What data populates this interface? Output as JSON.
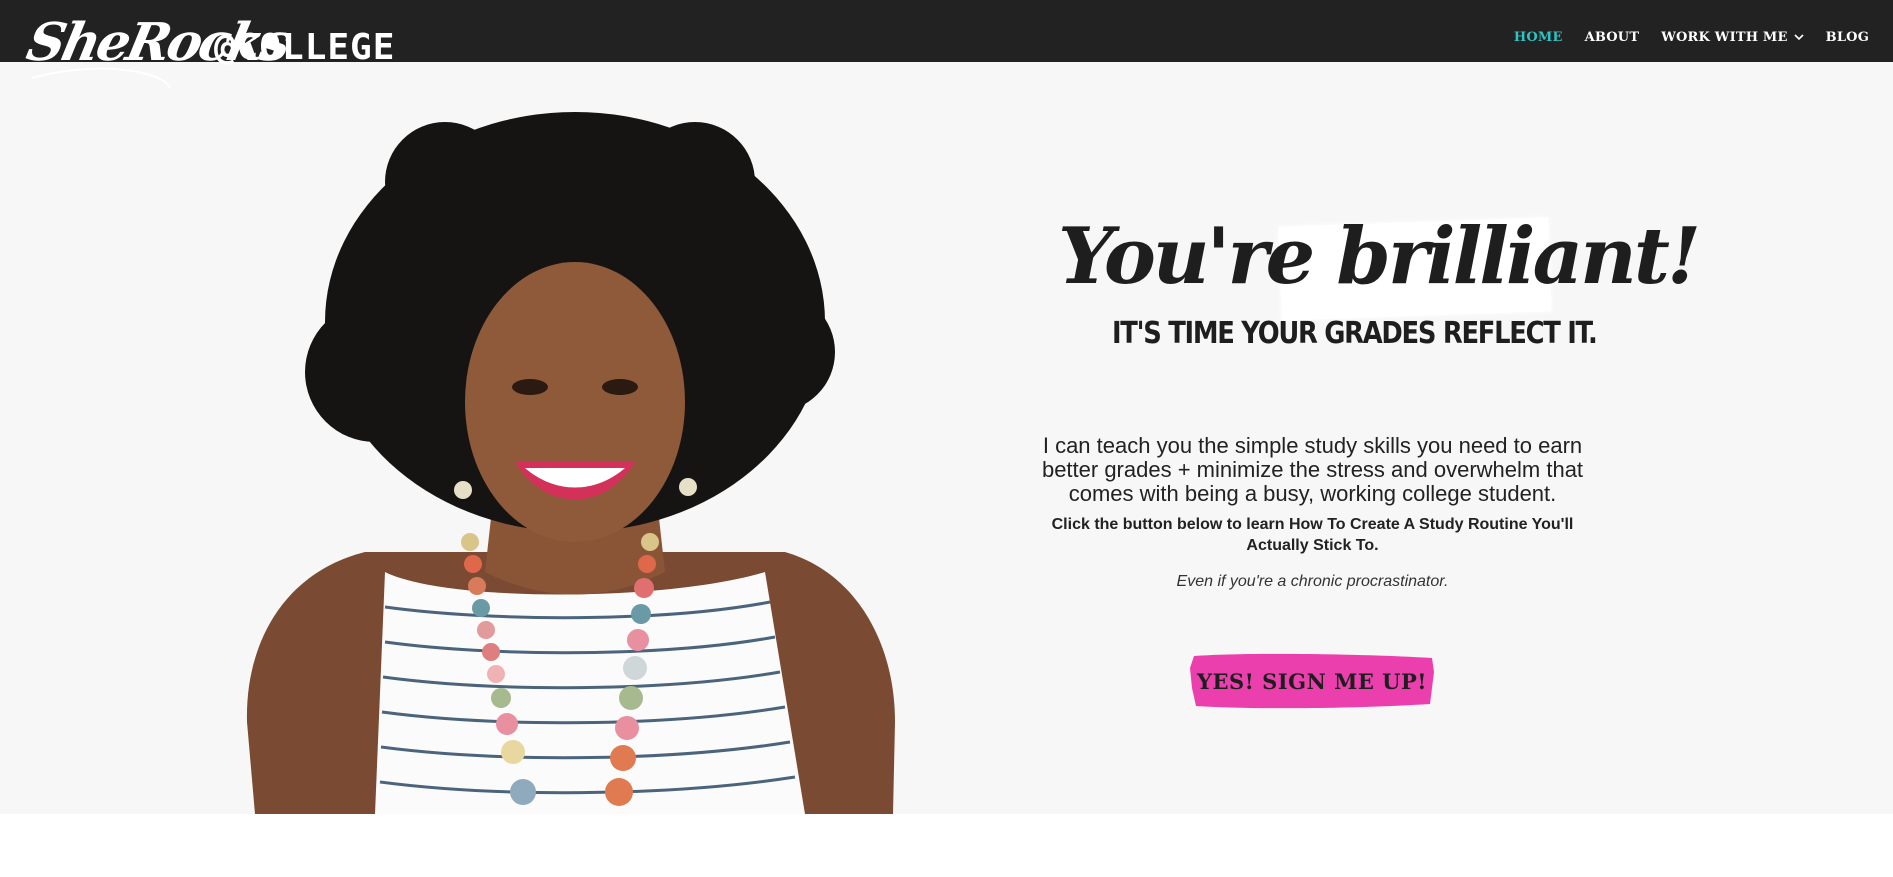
{
  "brand": {
    "script": "SheRocks",
    "tail": "@COLLEGE"
  },
  "nav": {
    "items": [
      {
        "label": "HOME",
        "active": true
      },
      {
        "label": "ABOUT",
        "active": false
      },
      {
        "label": "WORK WITH ME",
        "active": false,
        "has_dropdown": true
      },
      {
        "label": "BLOG",
        "active": false
      }
    ]
  },
  "hero": {
    "headline_part1": "You're ",
    "headline_part2": "brilliant!",
    "subheadline": "IT'S TIME YOUR GRADES REFLECT IT.",
    "lead": "I can teach you the simple study skills you need to earn better grades + minimize the stress and overwhelm that comes with being a busy, working college student.",
    "bold_line": "Click the button below to learn How To Create A Study Routine You'll Actually Stick To.",
    "italic_line": "Even if you're a chronic procrastinator.",
    "cta_label": "YES! SIGN ME UP!"
  },
  "colors": {
    "nav_bg": "#222222",
    "nav_active": "#2ec4c4",
    "hero_bg": "#f7f7f7",
    "cta_bg": "#ec3fae",
    "text_dark": "#1e1e1e"
  }
}
